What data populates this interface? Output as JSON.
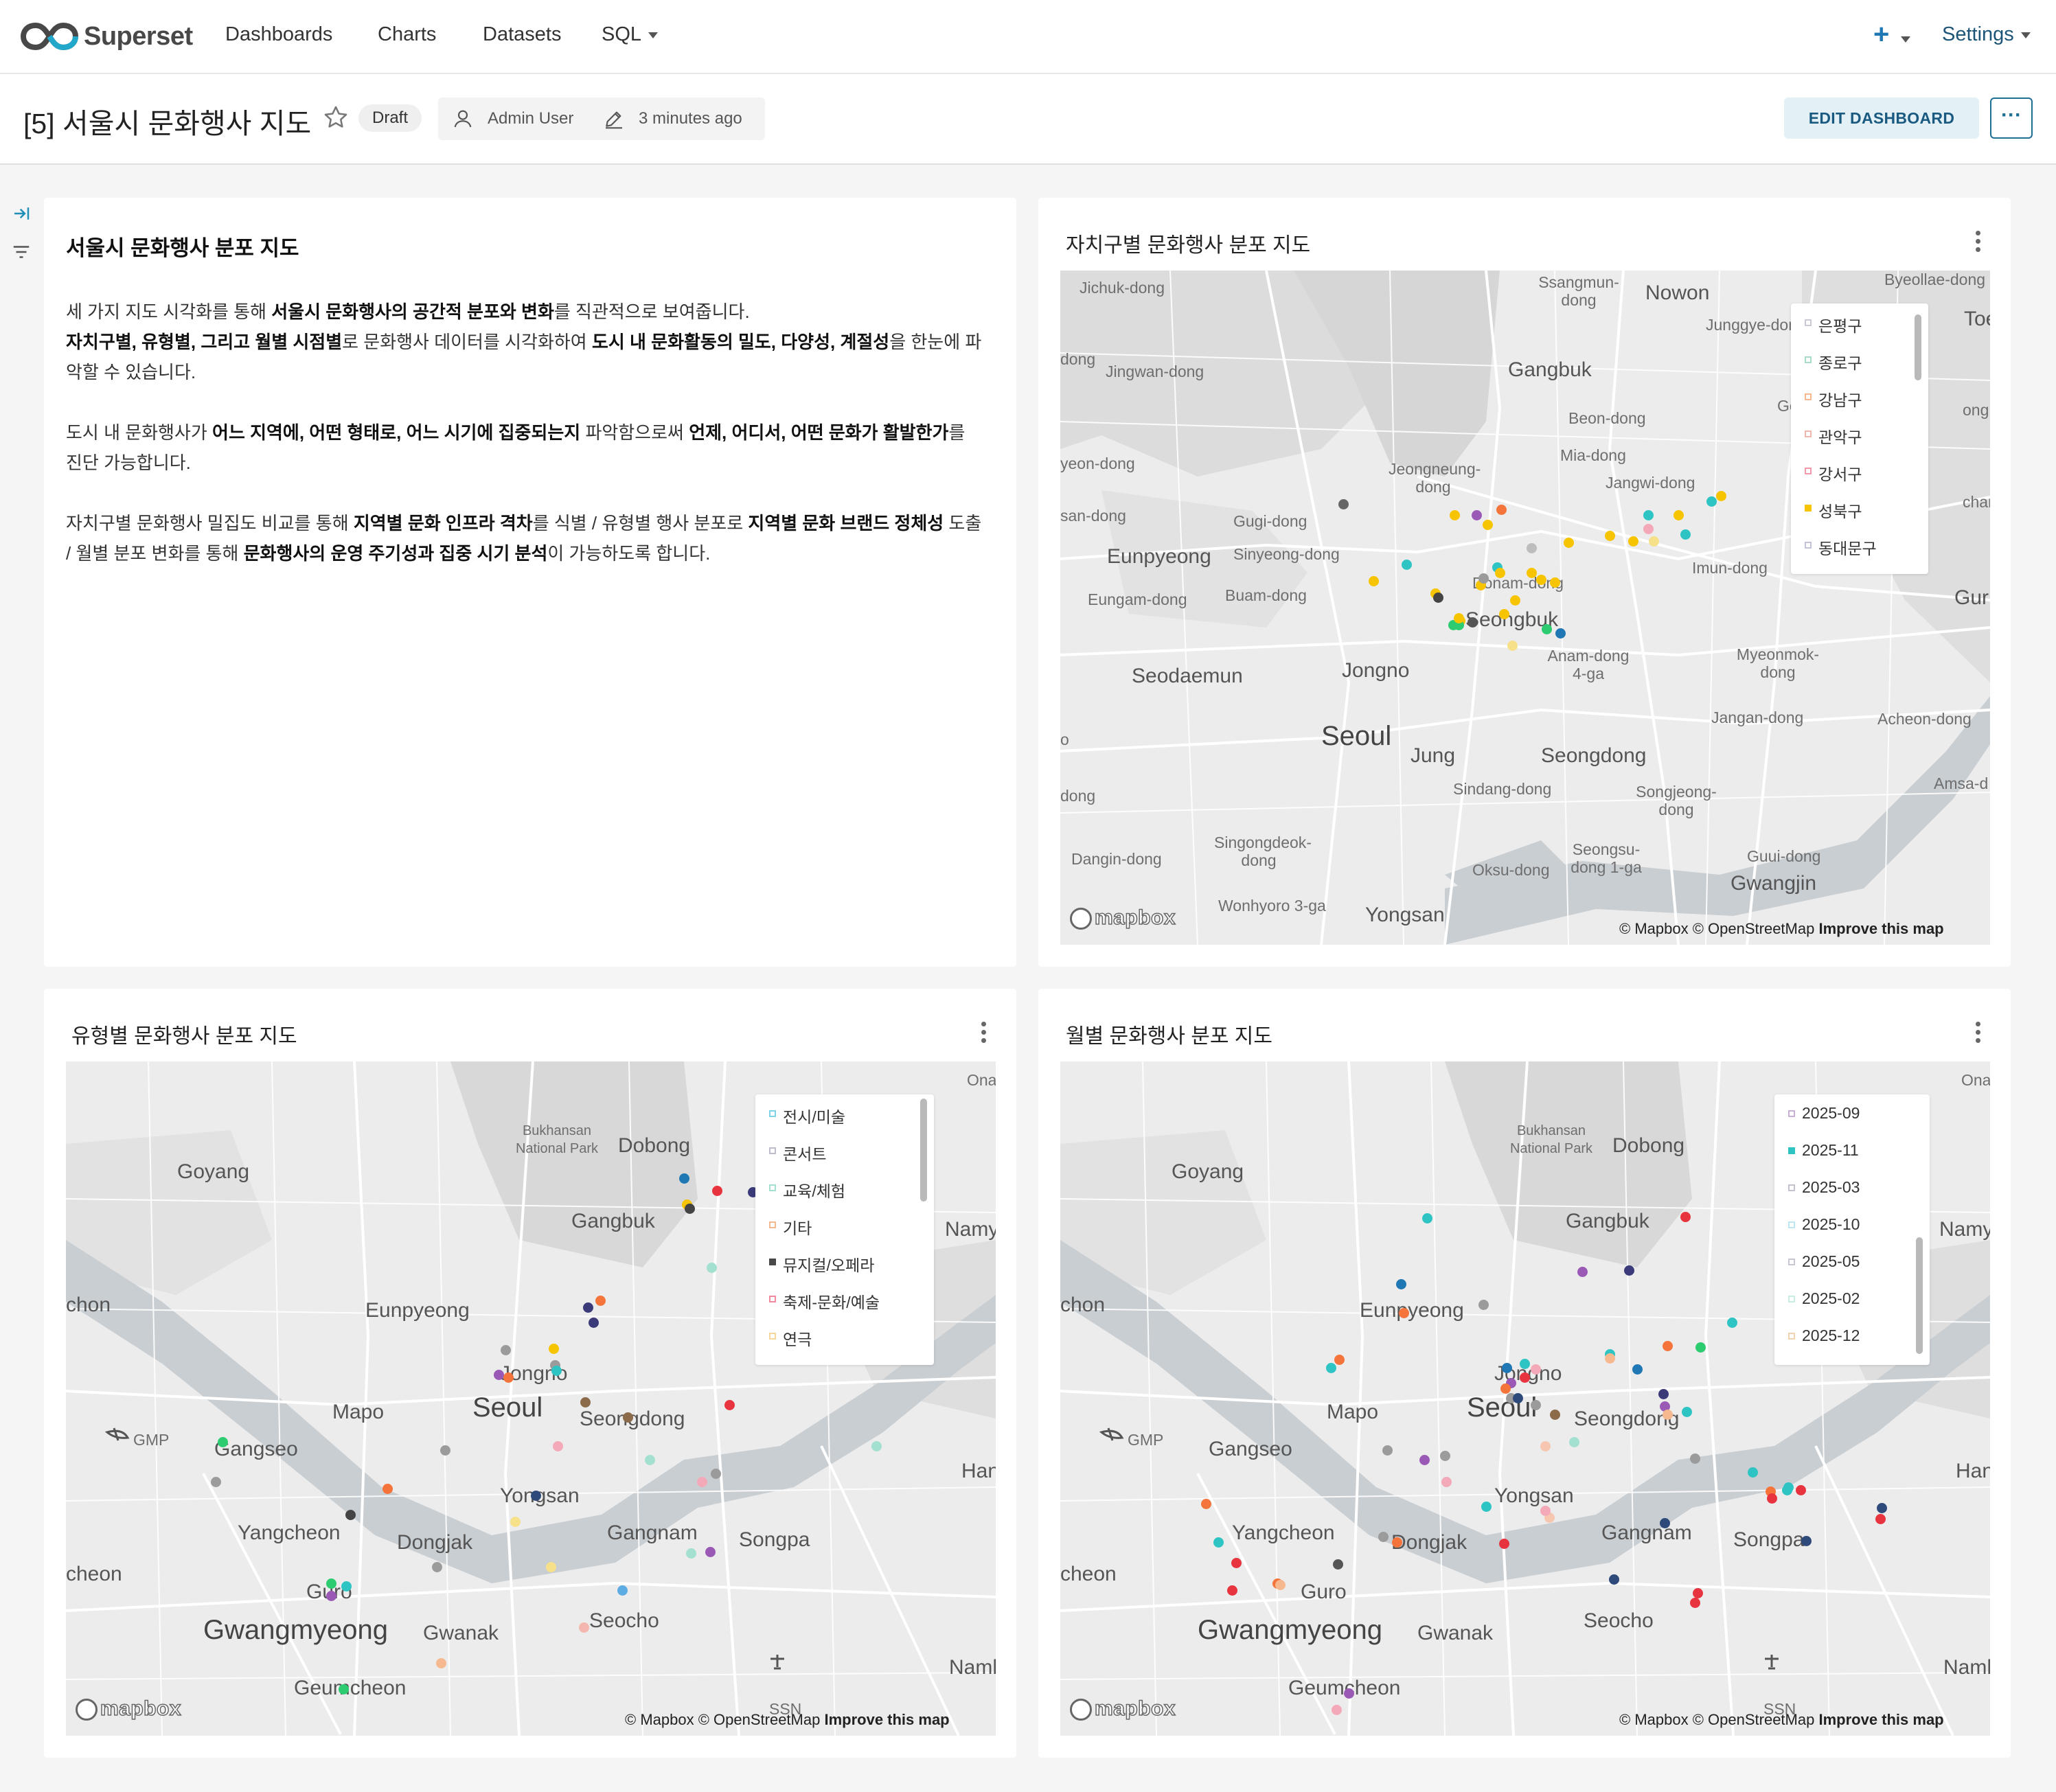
{
  "brand": {
    "name": "Superset"
  },
  "nav": {
    "dashboards": "Dashboards",
    "charts": "Charts",
    "datasets": "Datasets",
    "sql": "SQL",
    "plus": "+",
    "settings": "Settings"
  },
  "header": {
    "title": "[5] 서울시 문화행사 지도",
    "status": "Draft",
    "owner": "Admin User",
    "modified": "3 minutes ago",
    "edit_button": "EDIT DASHBOARD",
    "more_button": "···"
  },
  "markdown": {
    "title": "서울시 문화행사 분포 지도",
    "p1": [
      {
        "t": "세 가지 지도 시각화를 통해 ",
        "b": false
      },
      {
        "t": "서울시 문화행사의 공간적 분포와 변화",
        "b": true
      },
      {
        "t": "를 직관적으로 보여줍니다.",
        "b": false
      },
      {
        "br": true
      },
      {
        "t": "자치구별, 유형별, 그리고 월별 시점별",
        "b": true
      },
      {
        "t": "로 문화행사 데이터를 시각화하여 ",
        "b": false
      },
      {
        "t": "도시 내 문화활동의 밀도, 다양성, 계절성",
        "b": true
      },
      {
        "t": "을 한눈에 파악할 수 있습니다.",
        "b": false
      }
    ],
    "p2": [
      {
        "t": "도시 내 문화행사가 ",
        "b": false
      },
      {
        "t": "어느 지역에, 어떤 형태로, 어느 시기에 집중되는지",
        "b": true
      },
      {
        "t": " 파악함으로써 ",
        "b": false
      },
      {
        "t": "언제, 어디서, 어떤 문화가 활발한가",
        "b": true
      },
      {
        "t": "를 진단 가능합니다.",
        "b": false
      }
    ],
    "p3": [
      {
        "t": "자치구별 문화행사 밀집도 비교를 통해 ",
        "b": false
      },
      {
        "t": "지역별 문화 인프라 격차",
        "b": true
      },
      {
        "t": "를 식별 / 유형별 행사 분포로 ",
        "b": false
      },
      {
        "t": "지역별 문화 브랜드 정체성",
        "b": true
      },
      {
        "t": " 도출 / 월별 분포 변화를 통해 ",
        "b": false
      },
      {
        "t": "문화행사의 운영 주기성과 집중 시기 분석",
        "b": true
      },
      {
        "t": "이 가능하도록 합니다.",
        "b": false
      }
    ]
  },
  "charts": {
    "district": {
      "title": "자치구별 문화행사 분포 지도",
      "legend": [
        {
          "label": "은평구",
          "color": "#c9c9d8",
          "filled": false
        },
        {
          "label": "종로구",
          "color": "#a8dcc6",
          "filled": false
        },
        {
          "label": "강남구",
          "color": "#f6b98f",
          "filled": false
        },
        {
          "label": "관악구",
          "color": "#f4b7b0",
          "filled": false
        },
        {
          "label": "강서구",
          "color": "#f29aaa",
          "filled": false
        },
        {
          "label": "성북구",
          "color": "#f6c400",
          "filled": true
        },
        {
          "label": "동대문구",
          "color": "#c2c2d8",
          "filled": false
        }
      ],
      "places": {
        "p1": "Jichuk-dong",
        "p2": "Ssangmun-dong",
        "p3": "Nowon",
        "p4": "Byeollae-dong",
        "p5": "Toe",
        "p6": "Junggye-dong",
        "p7": "Gangbuk",
        "p8": "Jingwan-dong",
        "p9": "dong",
        "p10": "Gong",
        "p11": "ong",
        "p12": "Beon-dong",
        "p13": "Mia-dong",
        "p14": "yeon-dong",
        "p15": "Jeongneung-dong",
        "p16": "Jangwi-dong",
        "p17": "chang",
        "p18": "san-dong",
        "p19": "Gugi-dong",
        "p20": "Eunpyeong",
        "p21": "Sinyeong-dong",
        "p22": "Imun-dong",
        "p23": "Donam-dong",
        "p24": "Eungam-dong",
        "p25": "Buam-dong",
        "p26": "Seongbuk",
        "p27": "Gur",
        "p28": "Anam-dong 4-ga",
        "p29": "Myeonmok-dong",
        "p30": "Seodaemun",
        "p31": "Jongno",
        "p32": "Jangan-dong",
        "p33": "Acheon-dong",
        "p34": "Seoul",
        "p35": "Jung",
        "p36": "Seongdong",
        "p37": "o",
        "p38": "Sindang-dong",
        "p39": "Songjeong-dong",
        "p40": "Amsa-d",
        "p41": "dong",
        "p42": "Singongdeok-dong",
        "p43": "Seongsu-dong 1-ga",
        "p44": "Dangin-dong",
        "p45": "Oksu-dong",
        "p46": "Guui-dong",
        "p47": "Gwangjin",
        "p48": "Wonhyoro 3-ga",
        "p49": "Yongsan"
      },
      "attribution": "© Mapbox © OpenStreetMap",
      "improve": "Improve this map",
      "mapbox": "mapbox"
    },
    "category": {
      "title": "유형별 문화행사 분포 지도",
      "legend": [
        {
          "label": "전시/미술",
          "color": "#7ed3e6",
          "filled": false
        },
        {
          "label": "콘서트",
          "color": "#bdbdcc",
          "filled": false
        },
        {
          "label": "교육/체험",
          "color": "#a4e0d0",
          "filled": false
        },
        {
          "label": "기타",
          "color": "#f6b98f",
          "filled": false
        },
        {
          "label": "뮤지컬/오페라",
          "color": "#484848",
          "filled": true
        },
        {
          "label": "축제-문화/예술",
          "color": "#f08a9c",
          "filled": false
        },
        {
          "label": "연극",
          "color": "#f6d79a",
          "filled": false
        }
      ],
      "places": {
        "c1": "Ona",
        "c2": "Bukhansan National Park",
        "c3": "Dobong",
        "c4": "Goyang",
        "c5": "Gangbuk",
        "c6": "Namy",
        "c7": "chon",
        "c8": "Eunpyeong",
        "c9": "Jongno",
        "c10": "GMP",
        "c11": "Mapo",
        "c12": "Seoul",
        "c13": "Seongdong",
        "c14": "Gangseo",
        "c15": "Han",
        "c16": "Yongsan",
        "c17": "Yangcheon",
        "c18": "Gangnam",
        "c19": "Songpa",
        "c20": "Dongjak",
        "c21": "cheon",
        "c22": "Guro",
        "c23": "Gwangmyeong",
        "c24": "Seocho",
        "c25": "Gwanak",
        "c26": "Namh",
        "c27": "Geumcheon",
        "c28": "SSN"
      },
      "attribution": "© Mapbox © OpenStreetMap",
      "improve": "Improve this map",
      "mapbox": "mapbox"
    },
    "monthly": {
      "title": "월별 문화행사 분포 지도",
      "legend": [
        {
          "label": "2025-09",
          "color": "#c9b0d8",
          "filled": false
        },
        {
          "label": "2025-11",
          "color": "#2ec4c4",
          "filled": true
        },
        {
          "label": "2025-03",
          "color": "#c2c2d0",
          "filled": false
        },
        {
          "label": "2025-10",
          "color": "#bfe6f0",
          "filled": false
        },
        {
          "label": "2025-05",
          "color": "#c8c8d4",
          "filled": false
        },
        {
          "label": "2025-02",
          "color": "#c8eedf",
          "filled": false
        },
        {
          "label": "2025-12",
          "color": "#f6d3b0",
          "filled": false
        }
      ],
      "places": {
        "c1": "Ona",
        "c2": "Bukhansan National Park",
        "c3": "Dobong",
        "c4": "Goyang",
        "c5": "Gangbuk",
        "c6": "Namy",
        "c7": "chon",
        "c8": "Eunpyeong",
        "c9": "Jongno",
        "c10": "GMP",
        "c11": "Mapo",
        "c12": "Seoul",
        "c13": "Seongdong",
        "c14": "Gangseo",
        "c15": "Han",
        "c16": "Yongsan",
        "c17": "Yangcheon",
        "c18": "Gangnam",
        "c19": "Songpa",
        "c20": "Dongjak",
        "c21": "cheon",
        "c22": "Guro",
        "c23": "Gwangmyeong",
        "c24": "Seocho",
        "c25": "Gwanak",
        "c26": "Namh",
        "c27": "Geumcheon",
        "c28": "SSN"
      },
      "attribution": "© Mapbox © OpenStreetMap",
      "improve": "Improve this map",
      "mapbox": "mapbox"
    }
  }
}
